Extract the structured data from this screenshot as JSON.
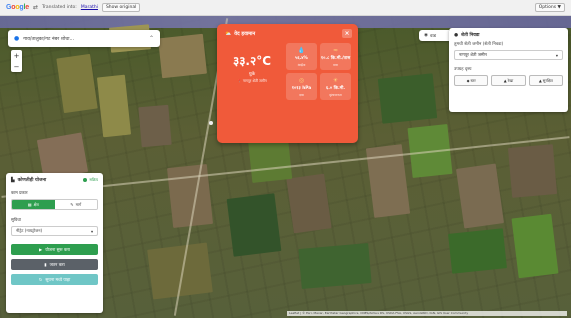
{
  "translate_bar": {
    "logo": [
      "G",
      "o",
      "o",
      "g",
      "l",
      "e"
    ],
    "translated_into_label": "Translated into:",
    "translated_into_lang": "Marathi",
    "show_original": "Show original",
    "options": "Options ▼"
  },
  "search": {
    "placeholder": "गाव/तालुका/गट नंबर शोधा..."
  },
  "zoom": {
    "in": "+",
    "out": "−"
  },
  "weather": {
    "title": "वेद हवामान",
    "close": "×",
    "temperature": "३३.२°C",
    "description": "धुके",
    "location": "नागपूर शेती जमीन",
    "stats": [
      {
        "icon": "humidity-icon",
        "glyph": "💧",
        "value": "५६.४%",
        "label": "आर्द्रता"
      },
      {
        "icon": "wind-icon",
        "glyph": "≈",
        "value": "१०.८ कि.मी./तास",
        "label": "वारा"
      },
      {
        "icon": "pressure-icon",
        "glyph": "◎",
        "value": "१०१३ hPa",
        "label": "दाब"
      },
      {
        "icon": "sun-icon",
        "glyph": "☀",
        "value": "६.० कि.मी.",
        "label": "दृश्यमानता"
      }
    ]
  },
  "partial_chip": {
    "label": "वाड"
  },
  "right_panel": {
    "title": "शेती निवडा",
    "subtitle": "तुमची शेती जमीन (शेती निवडा)",
    "select_value": "नागपूर शेती जमीन",
    "tools_label": "उपग्रह दृश्य",
    "buttons": [
      {
        "icon": "layers-icon",
        "glyph": "◆",
        "label": "स्तर"
      },
      {
        "icon": "draw-icon",
        "glyph": "▲",
        "label": "रेखा"
      },
      {
        "icon": "export-icon",
        "glyph": "▲",
        "label": "सुरक्षित"
      }
    ]
  },
  "left_panel": {
    "title": "कोणतीही योजना",
    "status": "सक्रिय",
    "mode_label": "काम प्रकार",
    "mode_on": "क्षेत्र",
    "mode_off": "मार्ग",
    "crop_label": "सुविधा",
    "crop_value": "नीट्रेट (नायट्रोजन)",
    "buttons": {
      "start": "योजना सुरू करा",
      "save": "जतन करा",
      "report": "सूचना मध्ये पाहा"
    }
  },
  "map": {
    "attribution": "Leaflet | © Esri, Maxar, Earthstar Geographics, CNES/Airbus DS, USDA FSA, USGS, AeroGRID, IGN, GIS User Community"
  },
  "colors": {
    "weather_card": "#f05a3a",
    "accent_green": "#2e9e4f",
    "dark_button": "#5b6168",
    "teal_button": "#6fc6c6"
  }
}
